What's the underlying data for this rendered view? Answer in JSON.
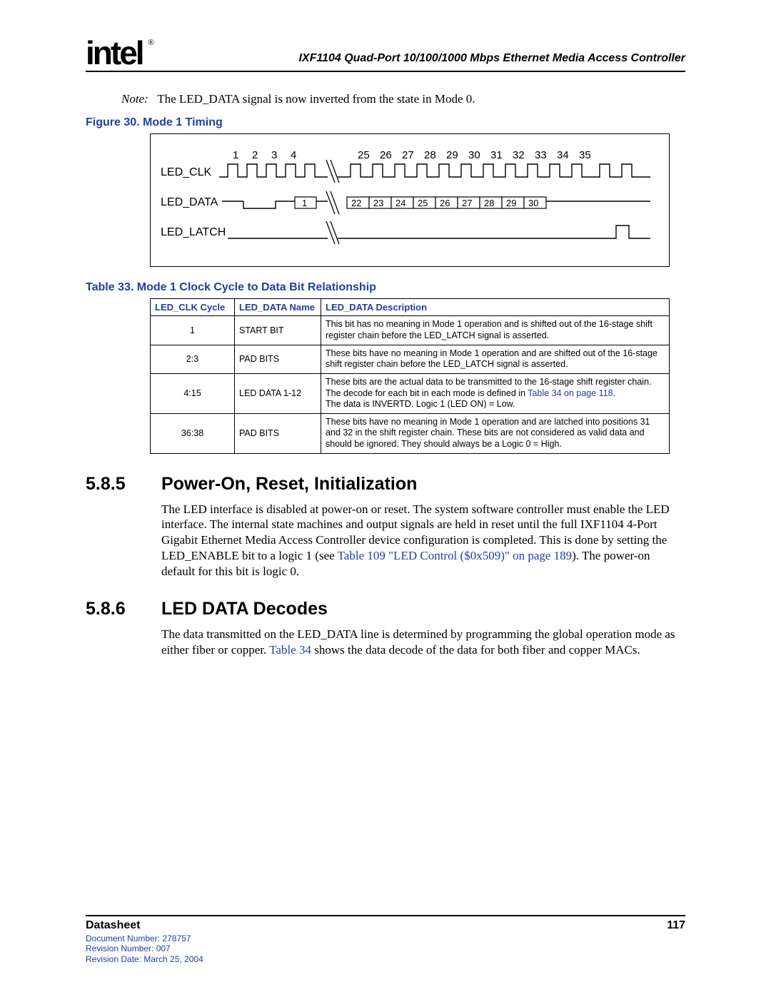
{
  "logo_text": "intel",
  "logo_reg": "®",
  "doc_title": "IXF1104 Quad-Port 10/100/1000 Mbps Ethernet Media Access Controller",
  "note": {
    "label": "Note:",
    "text": "The LED_DATA signal is now inverted from the state in Mode 0."
  },
  "figure_caption": "Figure 30. Mode 1 Timing",
  "timing": {
    "clk_numbers_left": [
      "1",
      "2",
      "3",
      "4"
    ],
    "clk_numbers_right": [
      "25",
      "26",
      "27",
      "28",
      "29",
      "30",
      "31",
      "32",
      "33",
      "34",
      "35"
    ],
    "signal_labels": {
      "clk": "LED_CLK",
      "data": "LED_DATA",
      "latch": "LED_LATCH"
    },
    "data_left_label": "1",
    "data_right_labels": [
      "22",
      "23",
      "24",
      "25",
      "26",
      "27",
      "28",
      "29",
      "30"
    ]
  },
  "table_caption": "Table 33. Mode 1 Clock Cycle to Data Bit Relationship",
  "table_headers": [
    "LED_CLK Cycle",
    "LED_DATA Name",
    "LED_DATA Description"
  ],
  "table_rows": [
    {
      "cycle": "1",
      "name": "START BIT",
      "desc": "This bit has no meaning in Mode 1 operation and is shifted out of the 16-stage shift register chain before the LED_LATCH signal is asserted."
    },
    {
      "cycle": "2:3",
      "name": "PAD BITS",
      "desc": "These bits have no meaning in Mode 1 operation and are shifted out of the 16-stage shift register chain before the LED_LATCH signal is asserted."
    },
    {
      "cycle": "4:15",
      "name": "LED DATA 1-12",
      "desc_pre": "These bits are the actual data to be transmitted to the 16-stage shift register chain. The decode for each bit in each mode is defined in ",
      "desc_link": "Table 34 on page 118",
      "desc_post": ".",
      "desc_line2": "The data is INVERTD. Logic 1 (LED ON) = Low."
    },
    {
      "cycle": "36:38",
      "name": "PAD BITS",
      "desc": "These bits have no meaning in Mode 1 operation and are latched into positions 31 and 32 in the shift register chain. These bits are not considered as valid data and should be ignored. They should always be a Logic 0 = High."
    }
  ],
  "sections": {
    "s1": {
      "num": "5.8.5",
      "title": "Power-On, Reset, Initialization",
      "body_pre": "The LED interface is disabled at power-on or reset. The system software controller must enable the LED interface. The internal state machines and output signals are held in reset until the full IXF1104 4-Port Gigabit Ethernet Media Access Controller device configuration is completed. This is done by setting the LED_ENABLE bit to a logic 1 (see ",
      "body_link": "Table 109 \"LED Control ($0x509)\" on page 189",
      "body_post": "). The power-on default for this bit is logic 0."
    },
    "s2": {
      "num": "5.8.6",
      "title": "LED DATA Decodes",
      "body_pre": "The data transmitted on the LED_DATA line is determined by programming the global operation mode as either fiber or copper. ",
      "body_link": "Table 34",
      "body_post": " shows the data decode of the data for both fiber and copper MACs."
    }
  },
  "footer": {
    "label": "Datasheet",
    "page": "117",
    "meta1": "Document Number: 278757",
    "meta2": "Revision Number: 007",
    "meta3": "Revision Date: March 25, 2004"
  }
}
